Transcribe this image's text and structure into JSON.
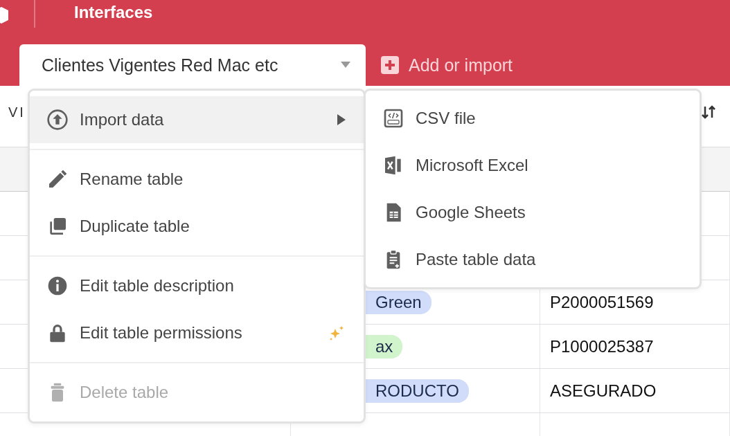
{
  "top_bar": {
    "title": "Interfaces"
  },
  "tabs": [
    {
      "label": "Clientes Vigentes Red Mac etc",
      "selected": true
    }
  ],
  "add_button": {
    "label": "Add or import"
  },
  "toolbar": {
    "left_text": "VI"
  },
  "table": {
    "rows": [
      {},
      {},
      {
        "column_2": {
          "label": "Green",
          "color": "#d0dcfa",
          "cut": true
        },
        "column_3": "P2000051569"
      },
      {
        "column_2": {
          "label": "ax",
          "color": "#d2f4cc",
          "cut": true
        },
        "column_3": "P1000025387"
      },
      {
        "column_2": {
          "label": "RODUCTO",
          "color": "#d0dcfa",
          "cut": true
        },
        "column_3": "ASEGURADO"
      }
    ]
  },
  "table_menu": {
    "groups": [
      {
        "items": [
          {
            "kind": "import",
            "label": "Import data",
            "selected": true,
            "disabled": false,
            "submenu": true,
            "ai_badge": false
          }
        ]
      },
      {
        "items": [
          {
            "kind": "rename",
            "label": "Rename table",
            "selected": false,
            "disabled": false,
            "submenu": false,
            "ai_badge": false
          },
          {
            "kind": "duplicate",
            "label": "Duplicate table",
            "selected": false,
            "disabled": false,
            "submenu": false,
            "ai_badge": false
          }
        ]
      },
      {
        "items": [
          {
            "kind": "info",
            "label": "Edit table description",
            "selected": false,
            "disabled": false,
            "submenu": false,
            "ai_badge": false
          },
          {
            "kind": "lock",
            "label": "Edit table permissions",
            "selected": false,
            "disabled": false,
            "submenu": false,
            "ai_badge": true
          }
        ]
      },
      {
        "items": [
          {
            "kind": "trash",
            "label": "Delete table",
            "selected": false,
            "disabled": true,
            "submenu": false,
            "ai_badge": false
          }
        ]
      }
    ]
  },
  "import_submenu": {
    "items": [
      {
        "kind": "csv",
        "label": "CSV file"
      },
      {
        "kind": "excel",
        "label": "Microsoft Excel"
      },
      {
        "kind": "sheets",
        "label": "Google Sheets"
      },
      {
        "kind": "paste",
        "label": "Paste table data"
      }
    ]
  }
}
